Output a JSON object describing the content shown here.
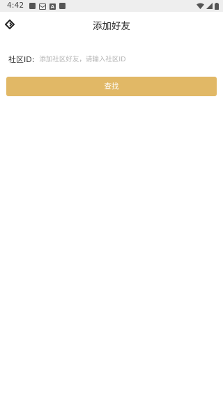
{
  "status_bar": {
    "time": "4:42",
    "icons_left": [
      "app-notification-icon",
      "mail-notification-icon",
      "font-notification-icon",
      "app-notification-icon"
    ],
    "icons_right": [
      "wifi-icon",
      "signal-icon",
      "battery-icon"
    ]
  },
  "nav": {
    "title": "添加好友",
    "back_icon": "back-diamond-icon"
  },
  "form": {
    "label": "社区ID:",
    "input_value": "",
    "input_placeholder": "添加社区好友，请输入社区ID"
  },
  "actions": {
    "search_label": "查找"
  },
  "colors": {
    "accent": "#e1b866",
    "status_bar_bg": "#eeeeee",
    "placeholder": "#b2b2b2"
  }
}
